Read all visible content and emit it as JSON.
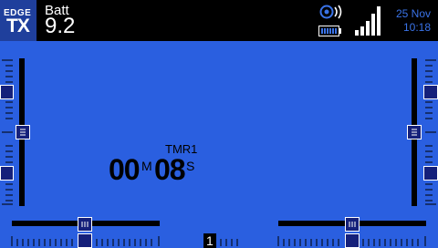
{
  "logo": {
    "line1": "EDGE",
    "line2": "TX"
  },
  "battery": {
    "label": "Batt",
    "value": "9.2"
  },
  "status": {
    "date": "25 Nov",
    "time": "10:18",
    "icons": [
      "speaker-volume-icon",
      "radio-battery-icon",
      "signal-bars-icon"
    ]
  },
  "timer": {
    "label": "TMR1",
    "minutes": "00",
    "minutes_unit": "M",
    "seconds": "08",
    "seconds_unit": "S"
  },
  "flight_mode": {
    "number": "1"
  },
  "colors": {
    "background": "#2a5fe0",
    "topbar": "#000000",
    "accent": "#3a73e8",
    "trim_thumb": "#15207a"
  }
}
